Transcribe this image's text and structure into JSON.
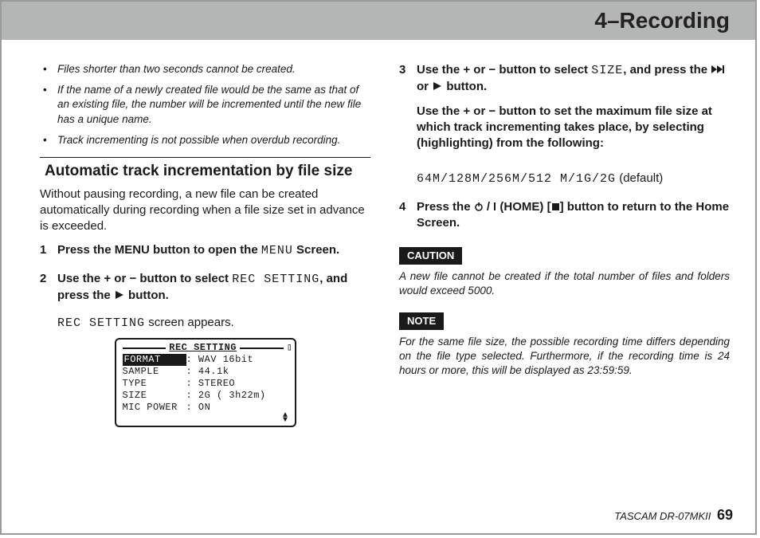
{
  "header": {
    "title": "4–Recording"
  },
  "left": {
    "bullets": [
      "Files shorter than two seconds cannot be created.",
      "If the name of a newly created file would be the same as that of an existing file, the number will be incremented until the new file has a unique name.",
      "Track incrementing is not possible when overdub recording."
    ],
    "section_heading": "Automatic track incrementation by file size",
    "intro": "Without pausing recording, a new file can be created automatically during recording when a file size set in advance is exceeded.",
    "step1_num": "1",
    "step1_a": "Press the MENU button to open the ",
    "step1_menu": "MENU",
    "step1_b": " Screen.",
    "step2_num": "2",
    "step2_a": "Use the + or − button to select ",
    "step2_rec": "REC SETTING",
    "step2_b": ", and press the ",
    "step2_c": " button.",
    "step2_sub_a": "REC SETTING",
    "step2_sub_b": " screen appears.",
    "screen": {
      "title": "REC SETTING",
      "rows": [
        {
          "k": "FORMAT",
          "v": ": WAV 16bit",
          "hl": true
        },
        {
          "k": "SAMPLE",
          "v": ": 44.1k"
        },
        {
          "k": "TYPE",
          "v": ": STEREO"
        },
        {
          "k": "SIZE",
          "v": ": 2G      ( 3h22m)"
        },
        {
          "k": "MIC POWER",
          "v": ": ON"
        }
      ]
    }
  },
  "right": {
    "step3_num": "3",
    "step3_a": "Use the + or − button to select ",
    "step3_size": "SIZE",
    "step3_b": ", and press the ",
    "step3_c": " or ",
    "step3_d": " button.",
    "step3_p2": "Use the + or − button to set the maximum file size at which track incrementing takes place, by selecting (highlighting) from the following:",
    "options_mono": "64M/128M/256M/512 M/1G/2G",
    "options_tail": " (default)",
    "step4_num": "4",
    "step4_a": "Press the ",
    "step4_b": "(HOME) [",
    "step4_c": "] button to return to the Home Screen.",
    "caution_label": "CAUTION",
    "caution_text": "A new file cannot be created if the total number of files and folders would exceed 5000.",
    "note_label": "NOTE",
    "note_text": "For the same file size, the possible recording time differs depending on the file type selected. Furthermore, if the recording time is 24 hours or more, this will be displayed as 23:59:59."
  },
  "footer": {
    "product": "TASCAM DR-07MKII",
    "page": "69"
  }
}
